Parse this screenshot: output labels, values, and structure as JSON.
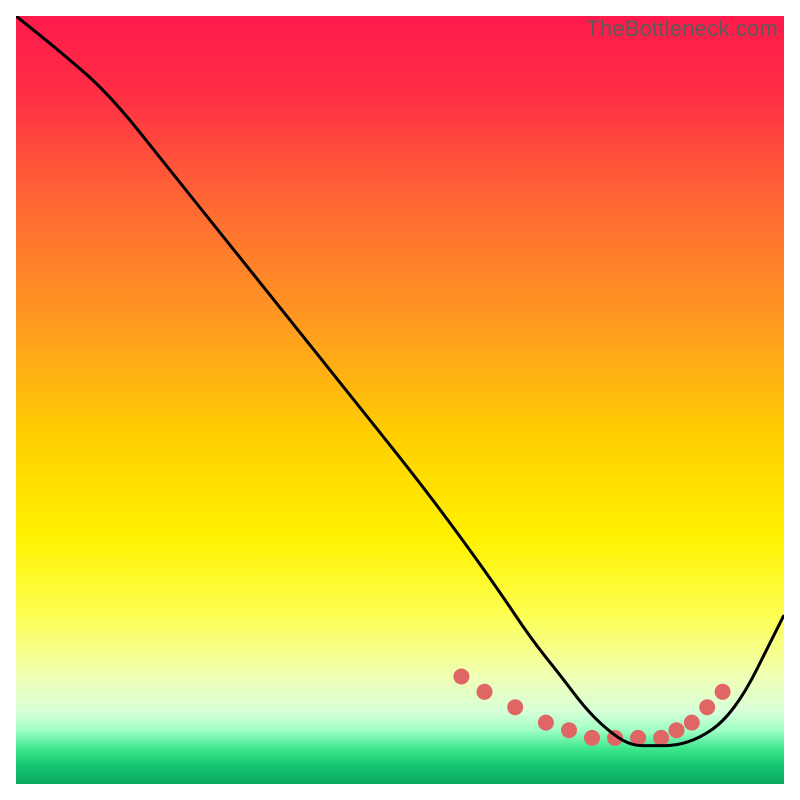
{
  "watermark": "TheBottleneck.com",
  "gradient_stops": [
    {
      "offset": 0.0,
      "color": "#ff1a4b"
    },
    {
      "offset": 0.1,
      "color": "#ff2e45"
    },
    {
      "offset": 0.25,
      "color": "#ff6a33"
    },
    {
      "offset": 0.4,
      "color": "#ff9a20"
    },
    {
      "offset": 0.55,
      "color": "#ffd000"
    },
    {
      "offset": 0.68,
      "color": "#fff200"
    },
    {
      "offset": 0.78,
      "color": "#fdff52"
    },
    {
      "offset": 0.86,
      "color": "#f0ffb4"
    },
    {
      "offset": 0.905,
      "color": "#d8ffd8"
    },
    {
      "offset": 0.93,
      "color": "#9fffc5"
    },
    {
      "offset": 0.955,
      "color": "#3ae58c"
    },
    {
      "offset": 0.975,
      "color": "#18c873"
    },
    {
      "offset": 1.0,
      "color": "#0aa85f"
    }
  ],
  "chart_data": {
    "type": "line",
    "title": "",
    "xlabel": "",
    "ylabel": "",
    "xlim": [
      0,
      100
    ],
    "ylim": [
      0,
      100
    ],
    "series": [
      {
        "name": "bottleneck-curve",
        "x": [
          0,
          5,
          12,
          20,
          28,
          36,
          44,
          52,
          58,
          63,
          67,
          71,
          74,
          77,
          80,
          83,
          86,
          89,
          92,
          95,
          98,
          100
        ],
        "y": [
          100,
          96,
          90,
          80,
          70,
          60,
          50,
          40,
          32,
          25,
          19,
          14,
          10,
          7,
          5,
          5,
          5,
          6,
          8,
          12,
          18,
          22
        ]
      }
    ],
    "markers": {
      "name": "highlight-dots",
      "x": [
        58,
        61,
        65,
        69,
        72,
        75,
        78,
        81,
        84,
        86,
        88,
        90,
        92
      ],
      "y": [
        14,
        12,
        10,
        8,
        7,
        6,
        6,
        6,
        6,
        7,
        8,
        10,
        12
      ],
      "color": "#e06666",
      "radius": 8
    }
  }
}
